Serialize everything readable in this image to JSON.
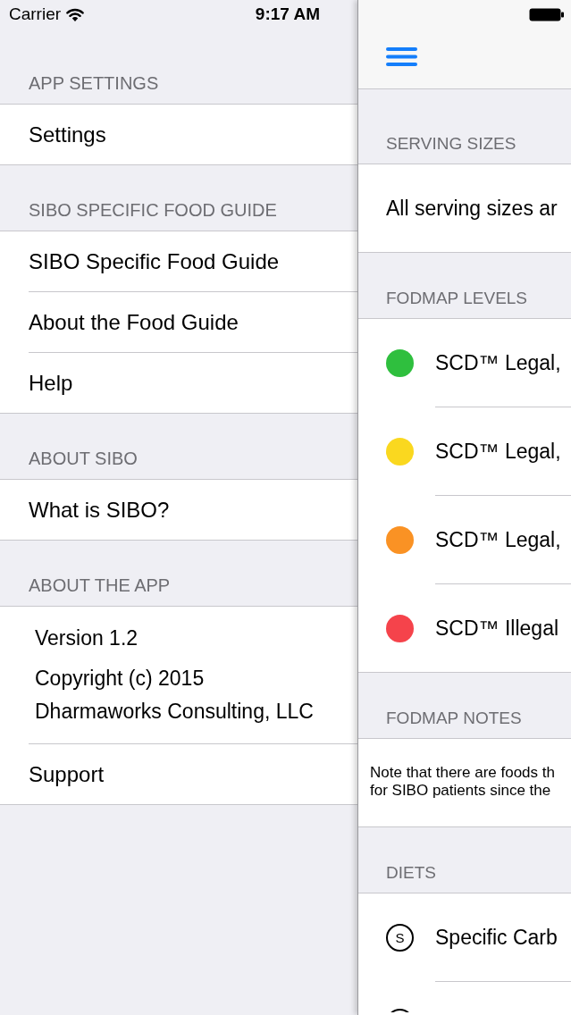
{
  "status_bar": {
    "carrier": "Carrier",
    "time": "9:17 AM"
  },
  "side_menu": {
    "sections": [
      {
        "header": "APP SETTINGS",
        "items": [
          {
            "kind": "link",
            "label": "Settings"
          }
        ]
      },
      {
        "header": "SIBO SPECIFIC FOOD GUIDE",
        "items": [
          {
            "kind": "link",
            "label": "SIBO Specific Food Guide"
          },
          {
            "kind": "link",
            "label": "About the Food Guide"
          },
          {
            "kind": "link",
            "label": "Help"
          }
        ]
      },
      {
        "header": "ABOUT SIBO",
        "items": [
          {
            "kind": "link",
            "label": "What is SIBO?"
          }
        ]
      },
      {
        "header": "ABOUT THE APP",
        "items": [
          {
            "kind": "info",
            "version": "Version 1.2",
            "copyright": "Copyright (c) 2015\nDharmaworks Consulting, LLC"
          },
          {
            "kind": "link",
            "label": "Support"
          }
        ]
      }
    ]
  },
  "content": {
    "sections": [
      {
        "header": "SERVING SIZES",
        "rows": [
          {
            "kind": "text",
            "label": "All serving sizes ar"
          }
        ]
      },
      {
        "header": "FODMAP LEVELS",
        "rows": [
          {
            "kind": "level",
            "color": "#2fbf3e",
            "label": "SCD™ Legal,"
          },
          {
            "kind": "level",
            "color": "#fad81f",
            "label": "SCD™ Legal,"
          },
          {
            "kind": "level",
            "color": "#fa9224",
            "label": "SCD™ Legal,"
          },
          {
            "kind": "level",
            "color": "#f5434b",
            "label": "SCD™ Illegal"
          }
        ]
      },
      {
        "header": "FODMAP NOTES",
        "rows": [
          {
            "kind": "note",
            "text": "Note that there are foods th\nfor SIBO patients since the"
          }
        ]
      },
      {
        "header": "DIETS",
        "rows": [
          {
            "kind": "diet",
            "badge": "S",
            "label": "Specific Carb"
          }
        ]
      }
    ]
  }
}
